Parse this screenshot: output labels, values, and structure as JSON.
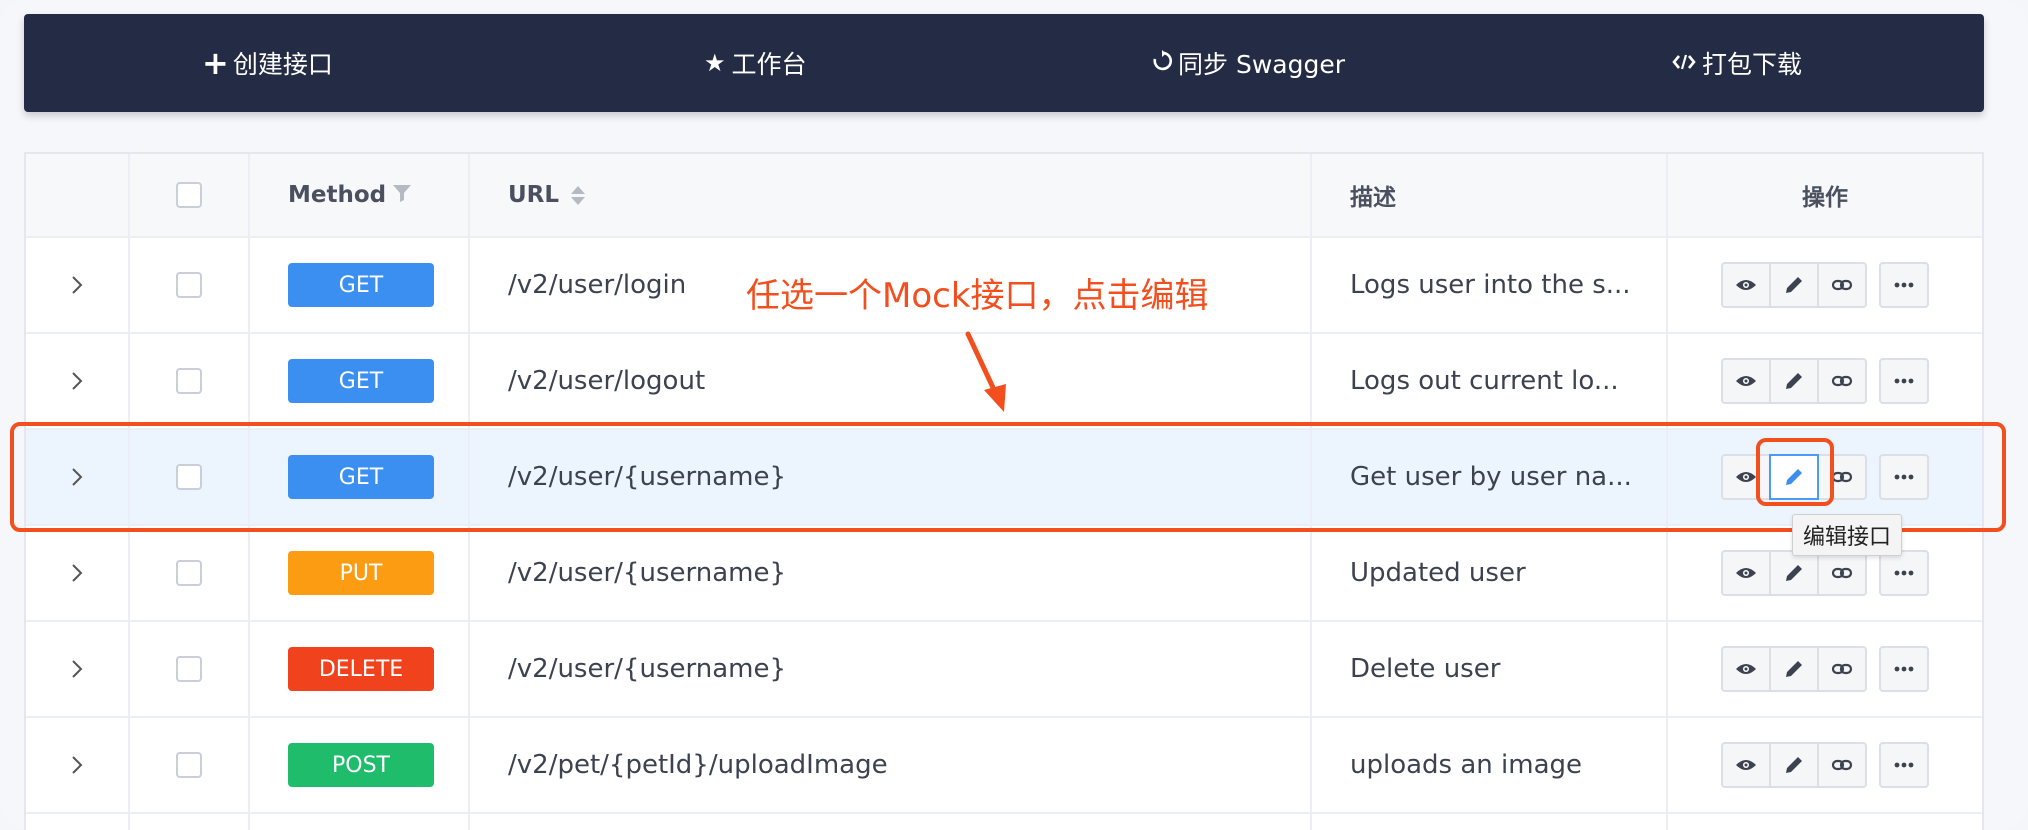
{
  "toolbar": {
    "items": [
      {
        "label": "创建接口",
        "icon": "plus-icon"
      },
      {
        "label": "工作台",
        "icon": "star-icon"
      },
      {
        "label": "同步 Swagger",
        "icon": "sync-icon"
      },
      {
        "label": "打包下载",
        "icon": "code-icon"
      }
    ]
  },
  "table": {
    "headers": {
      "method": "Method",
      "url": "URL",
      "description": "描述",
      "actions": "操作"
    },
    "rows": [
      {
        "method": "GET",
        "url": "/v2/user/login",
        "description": "Logs user into the s..."
      },
      {
        "method": "GET",
        "url": "/v2/user/logout",
        "description": "Logs out current lo..."
      },
      {
        "method": "GET",
        "url": "/v2/user/{username}",
        "description": "Get user by user na..."
      },
      {
        "method": "PUT",
        "url": "/v2/user/{username}",
        "description": "Updated user"
      },
      {
        "method": "DELETE",
        "url": "/v2/user/{username}",
        "description": "Delete user"
      },
      {
        "method": "POST",
        "url": "/v2/pet/{petId}/uploadImage",
        "description": "uploads an image"
      }
    ],
    "highlighted_row": 2
  },
  "annotation": {
    "text": "任选一个Mock接口，点击编辑",
    "color": "#f24e1e"
  },
  "tooltip": {
    "text": "编辑接口"
  },
  "colors": {
    "toolbar_bg": "#242b45",
    "get": "#3a8ff0",
    "put": "#fc9c12",
    "delete": "#f0421d",
    "post": "#1fbd6b"
  }
}
